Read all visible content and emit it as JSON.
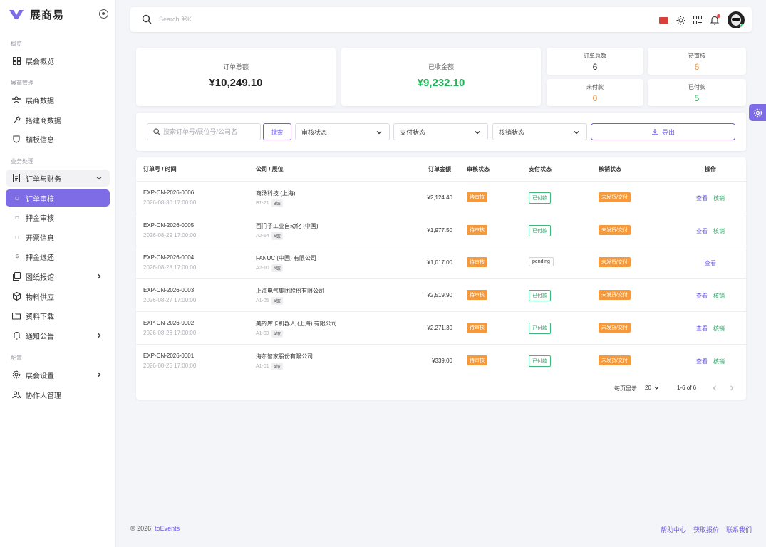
{
  "brand": {
    "name": "展商易",
    "accent": "#7d6ce6"
  },
  "sidebar": {
    "sections": [
      {
        "label": "概览"
      },
      {
        "label": "展商管理"
      },
      {
        "label": "业务处理"
      },
      {
        "label": "配置"
      }
    ],
    "items": [
      {
        "label": "展会概览",
        "icon": "dashboard-icon"
      },
      {
        "label": "展商数据",
        "icon": "users-icon"
      },
      {
        "label": "搭建商数据",
        "icon": "hammer-icon"
      },
      {
        "label": "楣板信息",
        "icon": "shield-icon"
      },
      {
        "label": "订单与财务",
        "icon": "receipt-icon"
      },
      {
        "label": "订单审核",
        "icon": "dot-icon"
      },
      {
        "label": "押金审核",
        "icon": "dot-icon"
      },
      {
        "label": "开票信息",
        "icon": "dot-icon"
      },
      {
        "label": "押金退还",
        "icon": "dollar-icon"
      },
      {
        "label": "图纸报馆",
        "icon": "files-icon"
      },
      {
        "label": "物料供应",
        "icon": "box-icon"
      },
      {
        "label": "资料下载",
        "icon": "folder-icon"
      },
      {
        "label": "通知公告",
        "icon": "bell-icon"
      },
      {
        "label": "展会设置",
        "icon": "gear-icon"
      },
      {
        "label": "协作人管理",
        "icon": "people-icon"
      }
    ]
  },
  "topbar": {
    "search_placeholder": "Search ⌘K"
  },
  "stats": {
    "total_amount": {
      "label": "订单总额",
      "value": "¥10,249.10"
    },
    "received": {
      "label": "已收金额",
      "value": "¥9,232.10",
      "color": "#22b35a"
    },
    "order_count": {
      "label": "订单总数",
      "value": "6"
    },
    "pending_review": {
      "label": "待审核",
      "value": "6",
      "color": "#f5923a"
    },
    "unpaid": {
      "label": "未付款",
      "value": "0",
      "color": "#f5923a"
    },
    "paid": {
      "label": "已付款",
      "value": "5",
      "color": "#22b35a"
    }
  },
  "filters": {
    "search_placeholder": "搜索订单号/展位号/公司名",
    "search_button": "搜索",
    "review_status": "审核状态",
    "pay_status": "支付状态",
    "verify_status": "核销状态",
    "export_button": "导出"
  },
  "table": {
    "headers": [
      "订单号 / 时间",
      "公司 / 展位",
      "订单金额",
      "审核状态",
      "支付状态",
      "核销状态",
      "操作"
    ],
    "rows": [
      {
        "order_no": "EXP-CN-2026-0006",
        "time": "2026-08-30 17:00:00",
        "company": "商汤科技 (上海)",
        "booth": "B1-21",
        "hall": "B馆",
        "amount": "¥2,124.40",
        "review": "待审核",
        "pay": "已付款",
        "verify": "未发货/交付",
        "view": "查看",
        "verify_action": "核销"
      },
      {
        "order_no": "EXP-CN-2026-0005",
        "time": "2026-08-29 17:00:00",
        "company": "西门子工业自动化 (中国)",
        "booth": "A2-14",
        "hall": "A馆",
        "amount": "¥1,977.50",
        "review": "待审核",
        "pay": "已付款",
        "verify": "未发货/交付",
        "view": "查看",
        "verify_action": "核销"
      },
      {
        "order_no": "EXP-CN-2026-0004",
        "time": "2026-08-28 17:00:00",
        "company": "FANUC (中国) 有限公司",
        "booth": "A2-10",
        "hall": "A馆",
        "amount": "¥1,017.00",
        "review": "待审核",
        "pay": "pending",
        "verify": "未发货/交付",
        "view": "查看",
        "verify_action": ""
      },
      {
        "order_no": "EXP-CN-2026-0003",
        "time": "2026-08-27 17:00:00",
        "company": "上海电气集团股份有限公司",
        "booth": "A1-05",
        "hall": "A馆",
        "amount": "¥2,519.90",
        "review": "待审核",
        "pay": "已付款",
        "verify": "未发货/交付",
        "view": "查看",
        "verify_action": "核销"
      },
      {
        "order_no": "EXP-CN-2026-0002",
        "time": "2026-08-26 17:00:00",
        "company": "美的库卡机器人 (上海) 有限公司",
        "booth": "A1-03",
        "hall": "A馆",
        "amount": "¥2,271.30",
        "review": "待审核",
        "pay": "已付款",
        "verify": "未发货/交付",
        "view": "查看",
        "verify_action": "核销"
      },
      {
        "order_no": "EXP-CN-2026-0001",
        "time": "2026-08-25 17:00:00",
        "company": "海尔智家股份有限公司",
        "booth": "A1-01",
        "hall": "A馆",
        "amount": "¥339.00",
        "review": "待审核",
        "pay": "已付款",
        "verify": "未发货/交付",
        "view": "查看",
        "verify_action": "核销"
      }
    ]
  },
  "pager": {
    "per_page_label": "每页显示",
    "per_page": "20",
    "range": "1-6 of 6"
  },
  "footer": {
    "copyright": "© 2026, ",
    "brand": "toEvents",
    "links": [
      "帮助中心",
      "获取报价",
      "联系我们"
    ]
  }
}
